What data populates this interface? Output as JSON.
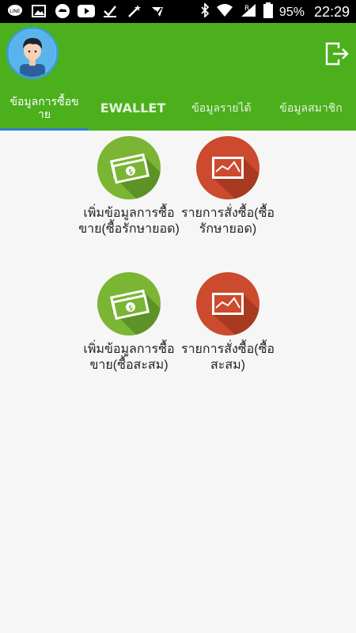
{
  "statusbar": {
    "battery_percent": "95%",
    "time": "22:29",
    "left_icons": [
      "line-icon",
      "image-icon",
      "weather-icon",
      "youtube-icon",
      "check-icon",
      "magic-wand-icon",
      "dolphin-icon"
    ],
    "right_icons": [
      "bluetooth-icon",
      "wifi-icon",
      "signal-icon",
      "battery-icon"
    ]
  },
  "appbar": {
    "color": "#4caf1c",
    "tabs": [
      {
        "label": "ข้อมูลการซื้อขาย",
        "active": true
      },
      {
        "label": "EWALLET",
        "active": false
      },
      {
        "label": "ข้อมูลรายได้",
        "active": false
      },
      {
        "label": "ข้อมูลสมาชิก",
        "active": false
      }
    ]
  },
  "menu": [
    {
      "label": "เพิ่มข้อมูลการซื้อขาย(ซื้อรักษายอด)",
      "icon": "money-icon",
      "color": "#7ab533"
    },
    {
      "label": "รายการสั่งซื้อ(ซื้อรักษายอด)",
      "icon": "chart-board-icon",
      "color": "#cc4a2e"
    },
    {
      "label": "เพิ่มข้อมูลการซื้อขาย(ซื้อสะสม)",
      "icon": "money-icon",
      "color": "#7ab533"
    },
    {
      "label": "รายการสั่งซื้อ(ซื้อสะสม)",
      "icon": "chart-board-icon",
      "color": "#cc4a2e"
    }
  ]
}
